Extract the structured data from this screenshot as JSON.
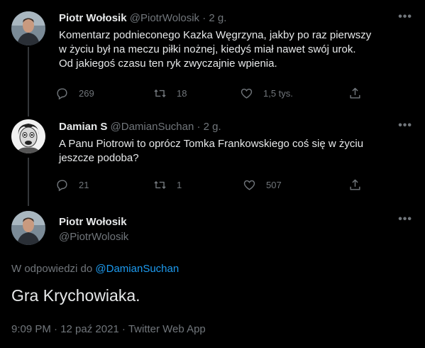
{
  "tweets": [
    {
      "name": "Piotr Wołosik",
      "handle": "@PiotrWolosik",
      "sep": "·",
      "time": "2 g.",
      "more": "•••",
      "lines": [
        "Komentarz podnieconego Kazka Węgrzyna, jakby po raz pierwszy",
        "w życiu był na meczu piłki nożnej, kiedyś miał nawet swój urok.",
        "Od jakiegoś czasu ten ryk zwyczajnie wpienia."
      ],
      "replies": "269",
      "retweets": "18",
      "likes": "1,5 tys."
    },
    {
      "name": "Damian S",
      "handle": "@DamianSuchan",
      "sep": "·",
      "time": "2 g.",
      "more": "•••",
      "lines": [
        "A Panu Piotrowi to oprócz Tomka Frankowskiego coś się w życiu",
        "jeszcze podoba?"
      ],
      "replies": "21",
      "retweets": "1",
      "likes": "507"
    }
  ],
  "main": {
    "name": "Piotr Wołosik",
    "handle": "@PiotrWolosik",
    "more": "•••",
    "reply_prefix": "W odpowiedzi do",
    "reply_to": "@DamianSuchan",
    "text": "Gra Krychowiaka.",
    "meta": "9:09 PM · 12 paź 2021 · Twitter Web App"
  },
  "colors": {
    "background": "#000000",
    "text": "#e7e9ea",
    "secondary": "#71767b",
    "link": "#1d9bf0",
    "thread_line": "#333639"
  },
  "icons": [
    "reply-icon",
    "retweet-icon",
    "like-icon",
    "share-icon",
    "more-icon"
  ]
}
